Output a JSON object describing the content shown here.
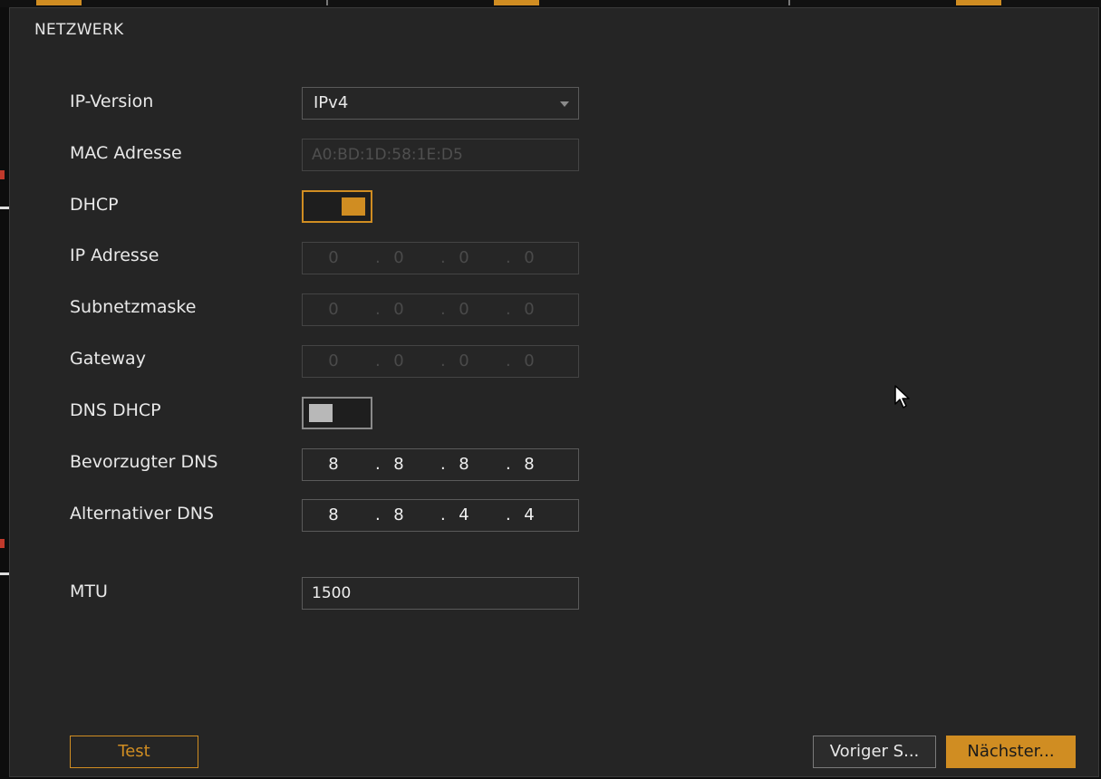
{
  "window": {
    "title": "NETZWERK"
  },
  "form": {
    "ip_version": {
      "label": "IP-Version",
      "value": "IPv4"
    },
    "mac": {
      "label": "MAC Adresse",
      "value": "A0:BD:1D:58:1E:D5"
    },
    "dhcp": {
      "label": "DHCP",
      "state": "on"
    },
    "ip": {
      "label": "IP Adresse",
      "octets": [
        "0",
        "0",
        "0",
        "0"
      ]
    },
    "subnet": {
      "label": "Subnetzmaske",
      "octets": [
        "0",
        "0",
        "0",
        "0"
      ]
    },
    "gateway": {
      "label": "Gateway",
      "octets": [
        "0",
        "0",
        "0",
        "0"
      ]
    },
    "dns_dhcp": {
      "label": "DNS DHCP",
      "state": "off"
    },
    "preferred_dns": {
      "label": "Bevorzugter DNS",
      "octets": [
        "8",
        "8",
        "8",
        "8"
      ]
    },
    "alternate_dns": {
      "label": "Alternativer DNS",
      "octets": [
        "8",
        "8",
        "4",
        "4"
      ]
    },
    "mtu": {
      "label": "MTU",
      "value": "1500"
    }
  },
  "buttons": {
    "test": "Test",
    "previous": "Voriger S...",
    "next": "Nächster..."
  },
  "colors": {
    "accent": "#d08d22",
    "background": "#252525",
    "toggle_off_knob": "#b8b8b8"
  },
  "icons": {
    "cursor": "mouse-pointer-icon",
    "dropdown": "caret-down-icon"
  }
}
